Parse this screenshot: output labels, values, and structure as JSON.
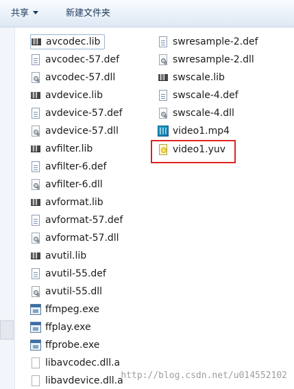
{
  "toolbar": {
    "share_label": "共享",
    "new_folder_label": "新建文件夹"
  },
  "files_col1": [
    {
      "name": "avcodec.lib",
      "icon": "lib-icon"
    },
    {
      "name": "avcodec-57.def",
      "icon": "def-icon"
    },
    {
      "name": "avcodec-57.dll",
      "icon": "dll-icon"
    },
    {
      "name": "avdevice.lib",
      "icon": "lib-icon"
    },
    {
      "name": "avdevice-57.def",
      "icon": "def-icon"
    },
    {
      "name": "avdevice-57.dll",
      "icon": "dll-icon"
    },
    {
      "name": "avfilter.lib",
      "icon": "lib-icon"
    },
    {
      "name": "avfilter-6.def",
      "icon": "def-icon"
    },
    {
      "name": "avfilter-6.dll",
      "icon": "dll-icon"
    },
    {
      "name": "avformat.lib",
      "icon": "lib-icon"
    },
    {
      "name": "avformat-57.def",
      "icon": "def-icon"
    },
    {
      "name": "avformat-57.dll",
      "icon": "dll-icon"
    },
    {
      "name": "avutil.lib",
      "icon": "lib-icon"
    },
    {
      "name": "avutil-55.def",
      "icon": "def-icon"
    },
    {
      "name": "avutil-55.dll",
      "icon": "dll-icon"
    },
    {
      "name": "ffmpeg.exe",
      "icon": "exe-icon"
    },
    {
      "name": "ffplay.exe",
      "icon": "exe-icon"
    },
    {
      "name": "ffprobe.exe",
      "icon": "exe-icon"
    },
    {
      "name": "libavcodec.dll.a",
      "icon": "file-icon"
    },
    {
      "name": "libavdevice.dll.a",
      "icon": "file-icon"
    }
  ],
  "files_col2": [
    {
      "name": "swresample-2.def",
      "icon": "def-icon"
    },
    {
      "name": "swresample-2.dll",
      "icon": "dll-icon"
    },
    {
      "name": "swscale.lib",
      "icon": "lib-icon"
    },
    {
      "name": "swscale-4.def",
      "icon": "def-icon"
    },
    {
      "name": "swscale-4.dll",
      "icon": "dll-icon"
    },
    {
      "name": "video1.mp4",
      "icon": "video-icon"
    },
    {
      "name": "video1.yuv",
      "icon": "yuv-file-icon"
    }
  ],
  "watermark": "http://blog.csdn.net/u014552102",
  "colors": {
    "highlight": "#e02020",
    "toolbar_text": "#1e395b"
  }
}
